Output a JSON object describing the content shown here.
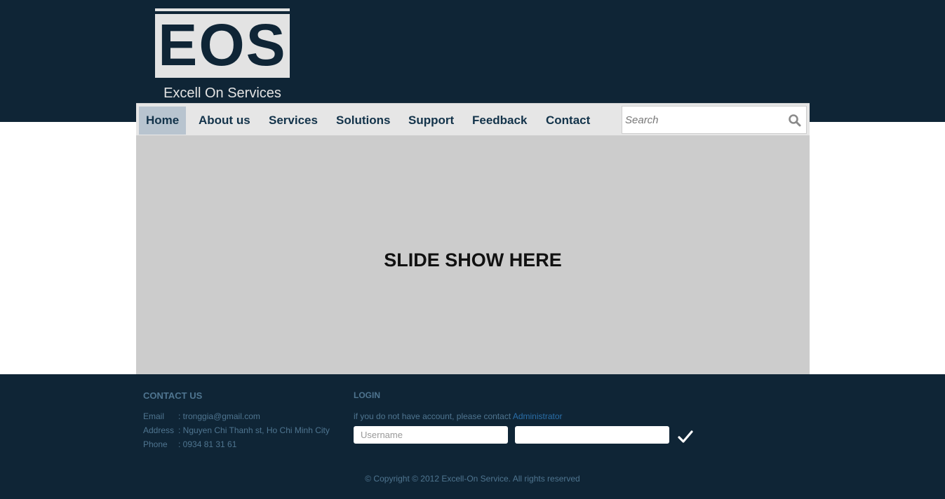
{
  "logo": {
    "letters": "EOS",
    "tagline": "Excell On Services"
  },
  "nav": {
    "items": [
      {
        "label": "Home",
        "active": true
      },
      {
        "label": "About us"
      },
      {
        "label": "Services"
      },
      {
        "label": "Solutions"
      },
      {
        "label": "Support"
      },
      {
        "label": "Feedback"
      },
      {
        "label": "Contact"
      }
    ],
    "search_placeholder": "Search"
  },
  "slideshow": {
    "caption": "SLIDE SHOW HERE"
  },
  "footer": {
    "contact": {
      "heading": "CONTACT US",
      "email_label": "Email",
      "email_value": ": tronggia@gmail.com",
      "address_label": "Address",
      "address_value": ": Nguyen Chi Thanh st, Ho Chi Minh City",
      "phone_label": "Phone",
      "phone_value": ": 0934 81 31 61"
    },
    "login": {
      "heading": "LOGIN",
      "note": "if you do not have account, please contact",
      "link": "Administrator",
      "username_placeholder": "Username",
      "password_placeholder": ""
    },
    "copyright": "© Copyright © 2012 Excell-On Service. All rights reserved"
  },
  "colors": {
    "header_bg": "#0f2536",
    "nav_bg": "#e6e6e6",
    "nav_active": "#b8c4cf",
    "slide_bg": "#cccccc",
    "footer_text": "#4f7590",
    "link": "#2a6ea8"
  }
}
